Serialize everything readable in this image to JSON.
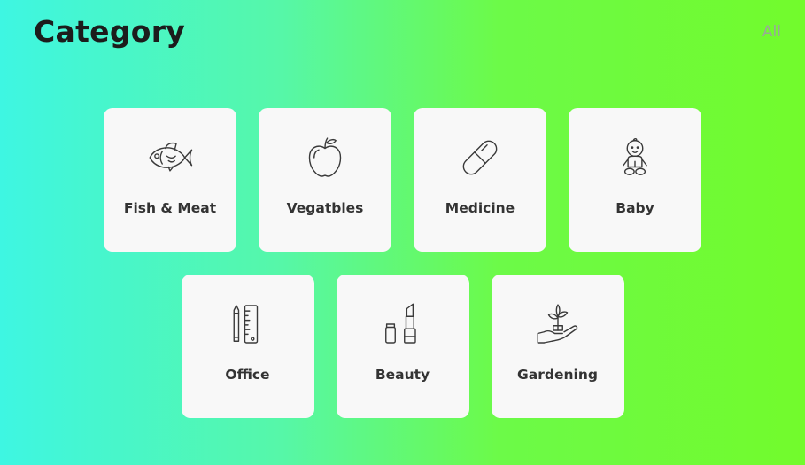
{
  "header": {
    "title": "Category",
    "all_label": "All"
  },
  "categories": [
    {
      "label": "Fish & Meat",
      "icon": "fish-icon"
    },
    {
      "label": "Vegatbles",
      "icon": "apple-icon"
    },
    {
      "label": "Medicine",
      "icon": "pill-icon"
    },
    {
      "label": "Baby",
      "icon": "baby-icon"
    },
    {
      "label": "Office",
      "icon": "pencil-ruler-icon"
    },
    {
      "label": "Beauty",
      "icon": "lipstick-icon"
    },
    {
      "label": "Gardening",
      "icon": "plant-hand-icon"
    }
  ],
  "colors": {
    "gradient_start": "#3ef6e2",
    "gradient_end": "#72fb2c",
    "card_background": "#f8f8f8",
    "title_text": "#1c1c1c",
    "all_link_text": "#9aa79a"
  }
}
